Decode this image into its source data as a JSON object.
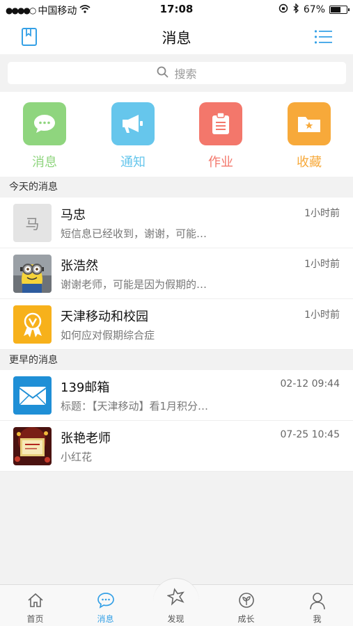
{
  "status_bar": {
    "signal": "●●●●○",
    "carrier": "中国移动",
    "time": "17:08",
    "battery_percent": "67%",
    "battery_level": 0.67
  },
  "header": {
    "title": "消息"
  },
  "search": {
    "placeholder": "搜索"
  },
  "quick_actions": [
    {
      "label": "消息",
      "color": "#8fd57e",
      "icon": "chat-icon"
    },
    {
      "label": "通知",
      "color": "#66c6ec",
      "icon": "megaphone-icon"
    },
    {
      "label": "作业",
      "color": "#f3776b",
      "icon": "clipboard-icon"
    },
    {
      "label": "收藏",
      "color": "#f7a93a",
      "icon": "star-folder-icon"
    }
  ],
  "sections": {
    "today": "今天的消息",
    "earlier": "更早的消息"
  },
  "messages_today": [
    {
      "name": "马忠",
      "preview": "短信息已经收到，谢谢，可能…",
      "time": "1小时前",
      "avatar_text": "马"
    },
    {
      "name": "张浩然",
      "preview": "谢谢老师，可能是因为假期的…",
      "time": "1小时前"
    },
    {
      "name": "天津移动和校园",
      "preview": "如何应对假期综合症",
      "time": "1小时前"
    }
  ],
  "messages_earlier": [
    {
      "name": "139邮箱",
      "preview": "标题：【天津移动】看1月积分…",
      "time": "02-12 09:44"
    },
    {
      "name": "张艳老师",
      "preview": "小红花",
      "time": "07-25 10:45"
    }
  ],
  "tabs": [
    {
      "label": "首页",
      "icon": "home-icon"
    },
    {
      "label": "消息",
      "icon": "chat-icon",
      "active": true
    },
    {
      "label": "发现",
      "icon": "discover-icon"
    },
    {
      "label": "成长",
      "icon": "sprout-icon"
    },
    {
      "label": "我",
      "icon": "person-icon"
    }
  ],
  "colors": {
    "accent": "#34a0e6"
  }
}
